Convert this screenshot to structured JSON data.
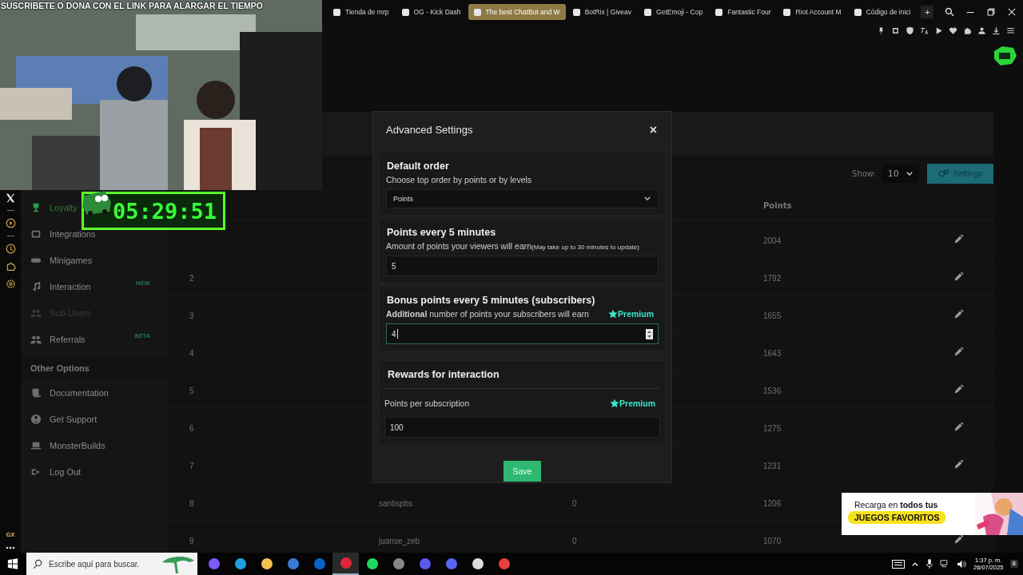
{
  "browser": {
    "tabs": [
      {
        "label": "Tienda de mrp",
        "selected": false
      },
      {
        "label": "OG - Kick Dash",
        "selected": false
      },
      {
        "label": "The best ChatBot and W",
        "selected": true
      },
      {
        "label": "BotRix | Giveav",
        "selected": false
      },
      {
        "label": "GetEmoji - Cop",
        "selected": false
      },
      {
        "label": "Fantastic Four",
        "selected": false
      },
      {
        "label": "Riot Account M",
        "selected": false
      },
      {
        "label": "Código de inici",
        "selected": false
      }
    ],
    "new_tab": "+"
  },
  "caption": "SUSCRIBETE O DONA CON EL LINK PARA ALARGAR EL TIEMPO",
  "timer": "05:29:51",
  "opera_sidebar": {
    "badge": "GX"
  },
  "sidebar": {
    "items": [
      {
        "label": "Loyalty",
        "selected": true,
        "disabled": false
      },
      {
        "label": "Integrations",
        "selected": false,
        "disabled": false
      },
      {
        "label": "Minigames",
        "selected": false,
        "disabled": false
      },
      {
        "label": "Interaction",
        "selected": false,
        "disabled": false,
        "badge": "NEW"
      },
      {
        "label": "Sub-Users",
        "selected": false,
        "disabled": true
      },
      {
        "label": "Referrals",
        "selected": false,
        "disabled": false,
        "badge": "BETA"
      }
    ],
    "other_heading": "Other Options",
    "other_items": [
      {
        "label": "Documentation"
      },
      {
        "label": "Get Support"
      },
      {
        "label": "MonsterBuilds"
      },
      {
        "label": "Log Out"
      }
    ]
  },
  "table": {
    "show_label": "Show:",
    "show_value": "10",
    "settings_button": "Settings",
    "points_header": "Points",
    "rows": [
      {
        "points": "2004"
      },
      {
        "rank": "2",
        "points": "1792"
      },
      {
        "rank": "3",
        "points": "1655"
      },
      {
        "rank": "4",
        "points": "1643"
      },
      {
        "rank": "5",
        "points": "1536"
      },
      {
        "rank": "6",
        "points": "1275"
      },
      {
        "rank": "7",
        "points": "1231"
      },
      {
        "rank": "8",
        "name": "santispbs",
        "column_3": "0",
        "points": "1206"
      },
      {
        "rank": "9",
        "name": "juanse_zeb",
        "column_3": "0",
        "points": "1070"
      }
    ]
  },
  "modal": {
    "title": "Advanced Settings",
    "close": "×",
    "save": "Save",
    "sections": [
      {
        "kind": "select",
        "heading": "Default order",
        "description": "Choose top order by points or by levels",
        "value": "Points"
      },
      {
        "kind": "input",
        "heading": "Points every 5 minutes",
        "description": "Amount of points your viewers will earn",
        "note": "(May take up to 30 minutes to update)",
        "value": "5",
        "focused": false
      },
      {
        "kind": "input",
        "heading": "Bonus points every 5 minutes (subscribers)",
        "description": "**Additional** number of points your subscribers will earn",
        "premium": "Premium",
        "value": "4",
        "focused": true
      },
      {
        "kind": "rewards",
        "heading": "Rewards for interaction",
        "label": "Points per subscription",
        "premium": "Premium",
        "value": "100"
      }
    ]
  },
  "banner": {
    "line_1": "Recarga en **todos tus**",
    "line_2": "JUEGOS FAVORITOS"
  },
  "taskbar": {
    "search_placeholder": "Escribe aquí para buscar.",
    "time": "1:37 p. m.",
    "date": "26/07/2025",
    "notifications": "8"
  }
}
